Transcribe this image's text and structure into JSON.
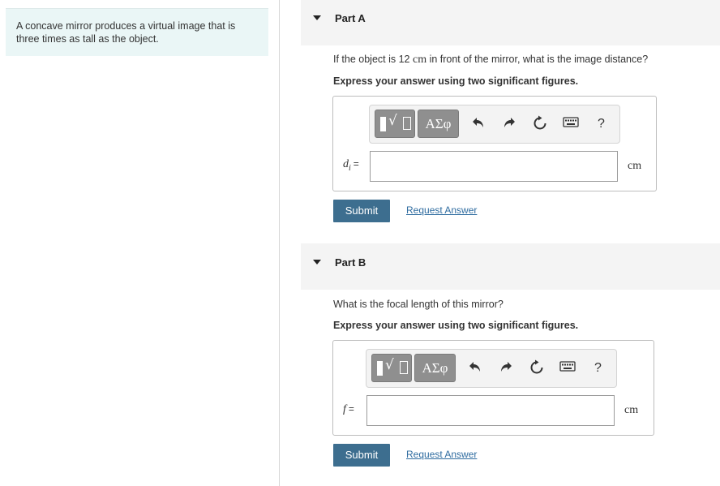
{
  "problem": {
    "text_line1": "A concave mirror produces a virtual image that is",
    "text_line2": "three times as tall as the object."
  },
  "parts": [
    {
      "title": "Part A",
      "question_pre": "If the object is 12 ",
      "question_unit": "cm",
      "question_post": " in front of the mirror, what is the image distance?",
      "instruction": "Express your answer using two significant figures.",
      "variable": "d",
      "variable_sub": "i",
      "equals": "=",
      "input_value": "",
      "unit": "cm",
      "submit_label": "Submit",
      "request_label": "Request Answer"
    },
    {
      "title": "Part B",
      "question": "What is the focal length of this mirror?",
      "instruction": "Express your answer using two significant figures.",
      "variable": "f",
      "equals": "=",
      "input_value": "",
      "unit": "cm",
      "submit_label": "Submit",
      "request_label": "Request Answer"
    }
  ],
  "toolbar": {
    "greek_label": "ΑΣφ",
    "help_label": "?",
    "icons": [
      "templates-icon",
      "greek-letters-icon",
      "undo-icon",
      "redo-icon",
      "reset-icon",
      "keyboard-icon",
      "help-icon"
    ]
  },
  "colors": {
    "submit_bg": "#3d6e8f",
    "link": "#2f6ca0",
    "problem_bg": "#eaf6f6",
    "part_header_bg": "#f4f4f4",
    "toolbar_button": "#8f8f8f"
  }
}
